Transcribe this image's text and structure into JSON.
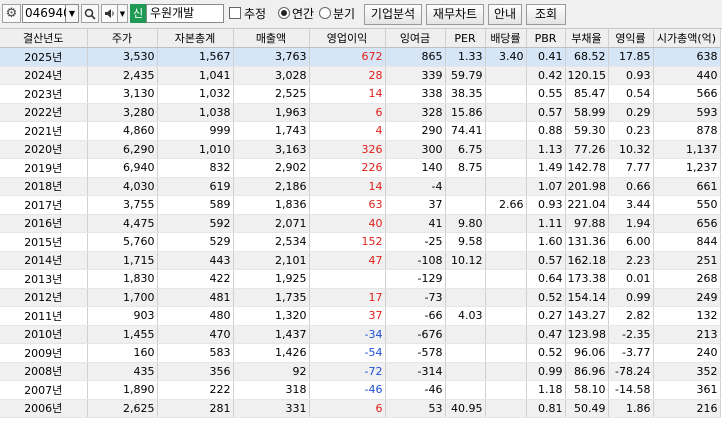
{
  "toolbar": {
    "stock_code": "046940",
    "market_badge": "신",
    "company_name": "우원개발",
    "estimate_label": "추정",
    "annual_label": "연간",
    "quarterly_label": "분기",
    "buttons": [
      "기업분석",
      "재무차트",
      "안내",
      "조회"
    ],
    "icons": [
      "gear-icon",
      "chevron-down-icon",
      "search-icon",
      "speaker-icon",
      "chevron-down-icon"
    ]
  },
  "table": {
    "headers": [
      "결산년도",
      "주가",
      "자본총계",
      "매출액",
      "영업이익",
      "잉여금",
      "PER",
      "배당률",
      "PBR",
      "부채율",
      "영익률",
      "시가총액(억)"
    ],
    "rows": [
      [
        "2025년",
        "3,530",
        "1,567",
        "3,763",
        "672",
        "865",
        "1.33",
        "3.40",
        "0.41",
        "68.52",
        "17.85",
        "638"
      ],
      [
        "2024년",
        "2,435",
        "1,041",
        "3,028",
        "28",
        "339",
        "59.79",
        "",
        "0.42",
        "120.15",
        "0.93",
        "440"
      ],
      [
        "2023년",
        "3,130",
        "1,032",
        "2,525",
        "14",
        "338",
        "38.35",
        "",
        "0.55",
        "85.47",
        "0.54",
        "566"
      ],
      [
        "2022년",
        "3,280",
        "1,038",
        "1,963",
        "6",
        "328",
        "15.86",
        "",
        "0.57",
        "58.99",
        "0.29",
        "593"
      ],
      [
        "2021년",
        "4,860",
        "999",
        "1,743",
        "4",
        "290",
        "74.41",
        "",
        "0.88",
        "59.30",
        "0.23",
        "878"
      ],
      [
        "2020년",
        "6,290",
        "1,010",
        "3,163",
        "326",
        "300",
        "6.75",
        "",
        "1.13",
        "77.26",
        "10.32",
        "1,137"
      ],
      [
        "2019년",
        "6,940",
        "832",
        "2,902",
        "226",
        "140",
        "8.75",
        "",
        "1.49",
        "142.78",
        "7.77",
        "1,237"
      ],
      [
        "2018년",
        "4,030",
        "619",
        "2,186",
        "14",
        "-4",
        "",
        "",
        "1.07",
        "201.98",
        "0.66",
        "661"
      ],
      [
        "2017년",
        "3,755",
        "589",
        "1,836",
        "63",
        "37",
        "",
        "2.66",
        "0.93",
        "221.04",
        "3.44",
        "550"
      ],
      [
        "2016년",
        "4,475",
        "592",
        "2,071",
        "40",
        "41",
        "9.80",
        "",
        "1.11",
        "97.88",
        "1.94",
        "656"
      ],
      [
        "2015년",
        "5,760",
        "529",
        "2,534",
        "152",
        "-25",
        "9.58",
        "",
        "1.60",
        "131.36",
        "6.00",
        "844"
      ],
      [
        "2014년",
        "1,715",
        "443",
        "2,101",
        "47",
        "-108",
        "10.12",
        "",
        "0.57",
        "162.18",
        "2.23",
        "251"
      ],
      [
        "2013년",
        "1,830",
        "422",
        "1,925",
        "",
        "-129",
        "",
        "",
        "0.64",
        "173.38",
        "0.01",
        "268"
      ],
      [
        "2012년",
        "1,700",
        "481",
        "1,735",
        "17",
        "-73",
        "",
        "",
        "0.52",
        "154.14",
        "0.99",
        "249"
      ],
      [
        "2011년",
        "903",
        "480",
        "1,320",
        "37",
        "-66",
        "4.03",
        "",
        "0.27",
        "143.27",
        "2.82",
        "132"
      ],
      [
        "2010년",
        "1,455",
        "470",
        "1,437",
        "-34",
        "-676",
        "",
        "",
        "0.47",
        "123.98",
        "-2.35",
        "213"
      ],
      [
        "2009년",
        "160",
        "583",
        "1,426",
        "-54",
        "-578",
        "",
        "",
        "0.52",
        "96.06",
        "-3.77",
        "240"
      ],
      [
        "2008년",
        "435",
        "356",
        "92",
        "-72",
        "-314",
        "",
        "",
        "0.99",
        "86.96",
        "-78.24",
        "352"
      ],
      [
        "2007년",
        "1,890",
        "222",
        "318",
        "-46",
        "-46",
        "",
        "",
        "1.18",
        "58.10",
        "-14.58",
        "361"
      ],
      [
        "2006년",
        "2,625",
        "281",
        "331",
        "6",
        "53",
        "40.95",
        "",
        "0.81",
        "50.49",
        "1.86",
        "216"
      ]
    ]
  },
  "colors": {
    "positive_profit": "#e0201b",
    "negative_profit": "#1f4fd6",
    "selected_row": "#d6e6f7"
  }
}
